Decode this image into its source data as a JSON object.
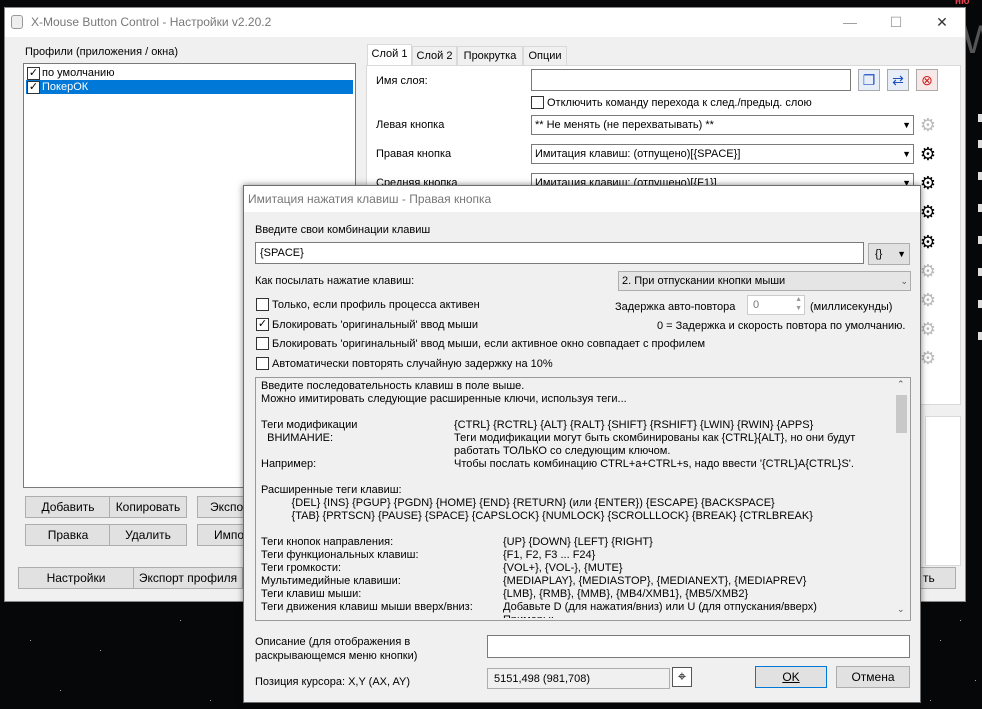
{
  "main": {
    "title": "X-Mouse Button Control - Настройки v2.20.2",
    "profiles_label": "Профили (приложения / окна)",
    "profiles": [
      {
        "label": "по умолчанию",
        "checked": true,
        "selected": false
      },
      {
        "label": "ПокерОК",
        "checked": true,
        "selected": true
      }
    ],
    "buttons": {
      "add": "Добавить",
      "copy": "Копировать",
      "export": "Экспор",
      "edit": "Правка",
      "delete": "Удалить",
      "import": "Импор",
      "settings": "Настройки",
      "export_profile": "Экспорт профиля",
      "apply": "ть"
    },
    "tabs": [
      "Слой 1",
      "Слой 2",
      "Прокрутка",
      "Опции"
    ],
    "layer_name_label": "Имя слоя:",
    "layer_name_value": "",
    "disable_layer_switch": "Отключить команду перехода к след./предыд. слою",
    "rows": [
      {
        "label": "Левая кнопка",
        "value": "** Не менять (не перехватывать) **"
      },
      {
        "label": "Правая кнопка",
        "value": "Имитация клавиш: (отпущено)[{SPACE}]"
      },
      {
        "label": "Средняя кнопка",
        "value": "Имитация клавиш: (отпущено)[{F1}]"
      }
    ],
    "right_edge_text": "ню"
  },
  "dialog": {
    "title": "Имитация нажатия клавиш - Правая кнопка",
    "enter_label": "Введите свои комбинации клавиш",
    "keys_value": "{SPACE}",
    "braces_btn": "{}",
    "send_label": "Как посылать нажатие клавиш:",
    "send_value": "2. При отпускании кнопки мыши",
    "only_active_label": "Только, если профиль процесса активен",
    "only_active_checked": false,
    "repeat_delay_label": "Задержка авто-повтора",
    "repeat_delay_value": "0",
    "ms_label": "(миллисекунды)",
    "block_orig_label": "Блокировать 'оригинальный' ввод мыши",
    "block_orig_checked": true,
    "zero_note": "0 = Задержка и скорость повтора по умолчанию.",
    "block_if_label": "Блокировать 'оригинальный' ввод мыши, если активное окно совпадает с профилем",
    "block_if_checked": false,
    "auto_repeat_label": "Автоматически повторять случайную задержку на 10%",
    "auto_repeat_checked": false,
    "help_lines": [
      {
        "a": "Введите последовательность клавиш в поле выше.",
        "b": ""
      },
      {
        "a": "Можно имитировать следующие расширенные ключи, используя теги...",
        "b": ""
      },
      {
        "a": "",
        "b": ""
      },
      {
        "a": "Теги модификации",
        "b": "{CTRL} {RCTRL} {ALT} {RALT} {SHIFT} {RSHIFT} {LWIN} {RWIN} {APPS}"
      },
      {
        "a": "  ВНИМАНИЕ:",
        "b": "Теги модификации могут быть скомбинированы как {CTRL}{ALT}, но они будут"
      },
      {
        "a": "",
        "b": "работать ТОЛЬКО со следующим ключом."
      },
      {
        "a": "Например:",
        "b": "Чтобы послать комбинацию CTRL+a+CTRL+s, надо ввести '{CTRL}A{CTRL}S'."
      },
      {
        "a": "",
        "b": ""
      },
      {
        "a": "Расширенные теги клавиш:",
        "b": ""
      },
      {
        "a": "          {DEL} {INS} {PGUP} {PGDN} {HOME} {END} {RETURN} (или {ENTER}) {ESCAPE} {BACKSPACE}",
        "b": ""
      },
      {
        "a": "          {TAB} {PRTSCN} {PAUSE} {SPACE} {CAPSLOCK} {NUMLOCK} {SCROLLLOCK} {BREAK} {CTRLBREAK}",
        "b": ""
      },
      {
        "a": "",
        "b": ""
      },
      {
        "a": "Теги кнопок направления:",
        "c": "{UP} {DOWN} {LEFT} {RIGHT}"
      },
      {
        "a": "Теги функциональных клавиш:",
        "c": "{F1, F2, F3 ... F24}"
      },
      {
        "a": "Теги громкости:",
        "c": "{VOL+}, {VOL-}, {MUTE}"
      },
      {
        "a": "Мультимедийные клавиши:",
        "c": "{MEDIAPLAY}, {MEDIASTOP}, {MEDIANEXT}, {MEDIAPREV}"
      },
      {
        "a": "Теги клавиш мыши:",
        "c": "{LMB}, {RMB}, {MMB}, {MB4/XMB1}, {MB5/XMB2}"
      },
      {
        "a": "Теги движения клавиш мыши вверх/вниз:",
        "c": "Добавьте D (для нажатия/вниз) или U (для отпускания/вверх)"
      },
      {
        "a": "",
        "c": "Примеры:"
      }
    ],
    "description_label": "Описание (для отображения в раскрывающемся меню кнопки)",
    "description_value": "",
    "cursor_label": "Позиция курсора: X,Y (AX, AY)",
    "cursor_value": "5151,498 (981,708)",
    "ok": "OK",
    "cancel": "Отмена"
  }
}
